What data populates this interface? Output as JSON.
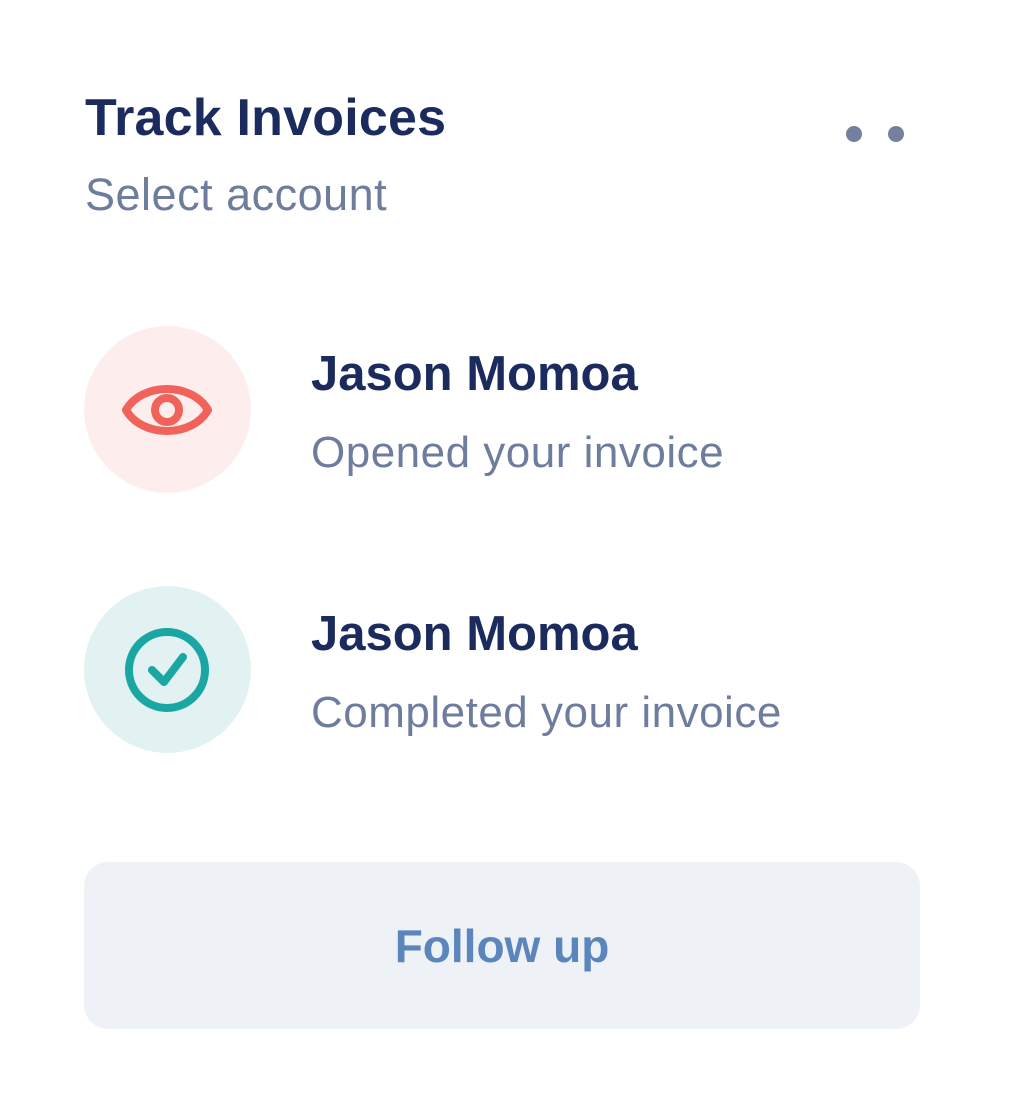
{
  "header": {
    "title": "Track Invoices",
    "subtitle": "Select account",
    "more_icon": "more-dots-icon"
  },
  "activities": [
    {
      "name": "Jason Momoa",
      "status": "Opened your invoice",
      "icon": "eye-icon",
      "icon_color": "#f0625a",
      "bubble_color": "#fdeeed"
    },
    {
      "name": "Jason Momoa",
      "status": "Completed your invoice",
      "icon": "check-circle-icon",
      "icon_color": "#1aa6a2",
      "bubble_color": "#e2f2f2"
    }
  ],
  "actions": {
    "follow_up_label": "Follow up"
  },
  "colors": {
    "title": "#1c2b5e",
    "muted": "#6e7c9d",
    "button_bg": "#eef2f7",
    "button_text": "#5a86bd"
  }
}
